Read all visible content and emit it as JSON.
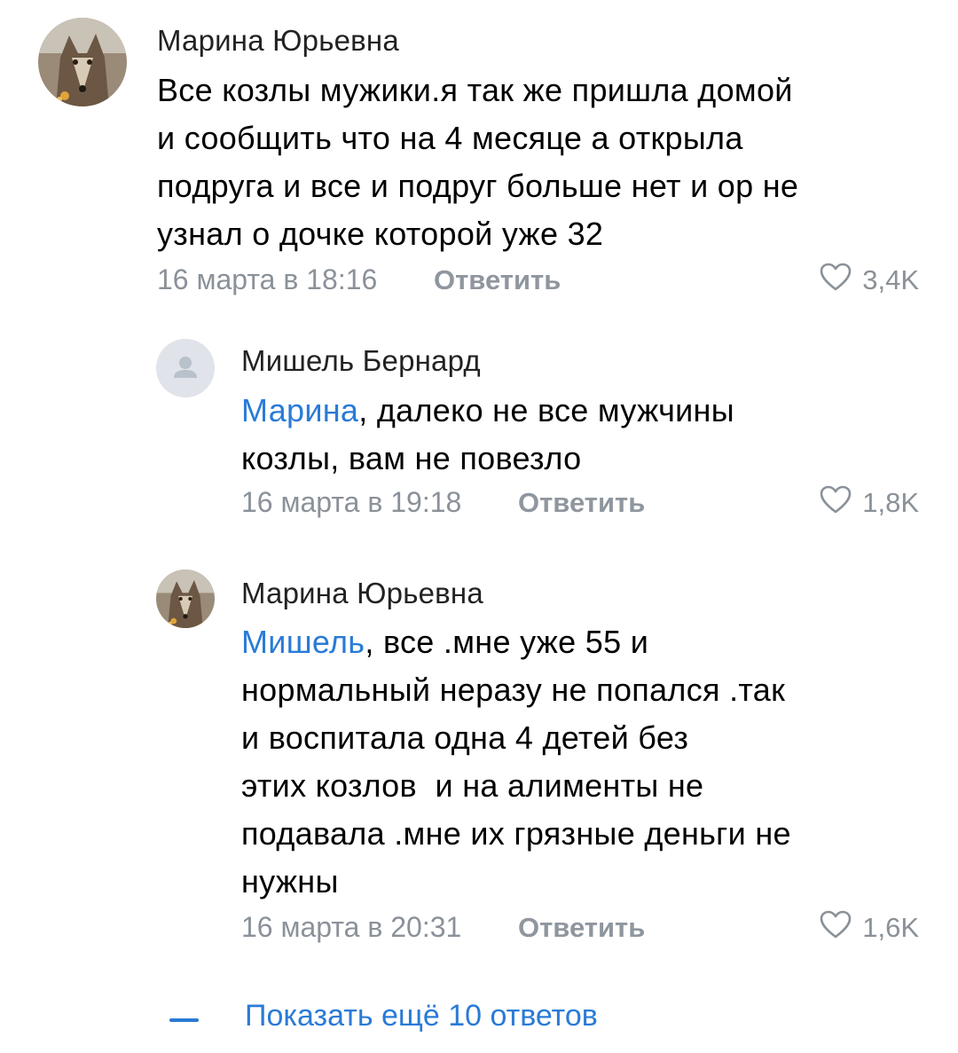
{
  "comments": [
    {
      "author": "Марина Юрьевна",
      "avatar": "wolf-avatar",
      "text_lines": [
        "Все козлы мужики.я так же пришла домой",
        "и сообщить что на 4 месяце а открыла",
        "подруга и все и подруг больше нет и ор не",
        "узнал о дочке которой уже 32"
      ],
      "date": "16 марта в 18:16",
      "reply_label": "Ответить",
      "likes": "3,4K"
    },
    {
      "author": "Мишель Бернард",
      "avatar": "placeholder-user-avatar",
      "mention": "Марина",
      "first_line_rest": ", далеко не все мужчины",
      "text_lines": [
        "козлы, вам не повезло"
      ],
      "date": "16 марта в 19:18",
      "reply_label": "Ответить",
      "likes": "1,8K"
    },
    {
      "author": "Марина Юрьевна",
      "avatar": "wolf-avatar",
      "mention": "Мишель",
      "first_line_rest": ", все .мне уже 55 и",
      "text_lines": [
        "нормальный неразу не попался .так",
        "и воспитала одна 4 детей без",
        "этих козлов  и на алименты не",
        "подавала .мне их грязные деньги не",
        "нужны"
      ],
      "date": "16 марта в 20:31",
      "reply_label": "Ответить",
      "likes": "1,6K"
    }
  ],
  "show_more": {
    "label": "Показать ещё 10 ответов"
  },
  "colors": {
    "link": "#2a7bd6",
    "meta": "#8a9199",
    "text": "#000000"
  }
}
